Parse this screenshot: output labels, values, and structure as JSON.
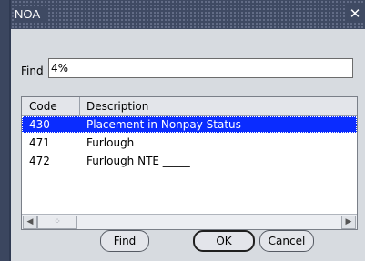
{
  "dialog": {
    "title": "NOA",
    "close_glyph": "✕"
  },
  "search": {
    "label": "Find",
    "value": "4%"
  },
  "list": {
    "columns": {
      "code": "Code",
      "description": "Description"
    },
    "rows": [
      {
        "code": "430",
        "description": "Placement in Nonpay Status",
        "selected": true
      },
      {
        "code": "471",
        "description": "Furlough",
        "selected": false
      },
      {
        "code": "472",
        "description": "Furlough NTE _____",
        "selected": false
      }
    ],
    "scroll_left_glyph": "◀",
    "scroll_right_glyph": "▶",
    "scroll_thumb_glyph": "⁘"
  },
  "buttons": {
    "find": {
      "mnemonic": "F",
      "rest": "ind"
    },
    "ok": {
      "mnemonic": "O",
      "rest": "K"
    },
    "cancel": {
      "mnemonic": "C",
      "rest": "ancel"
    }
  },
  "colors": {
    "titlebar": "#3f4a63",
    "dialog_bg": "#d7dbe0",
    "selection": "#0a2cff"
  }
}
